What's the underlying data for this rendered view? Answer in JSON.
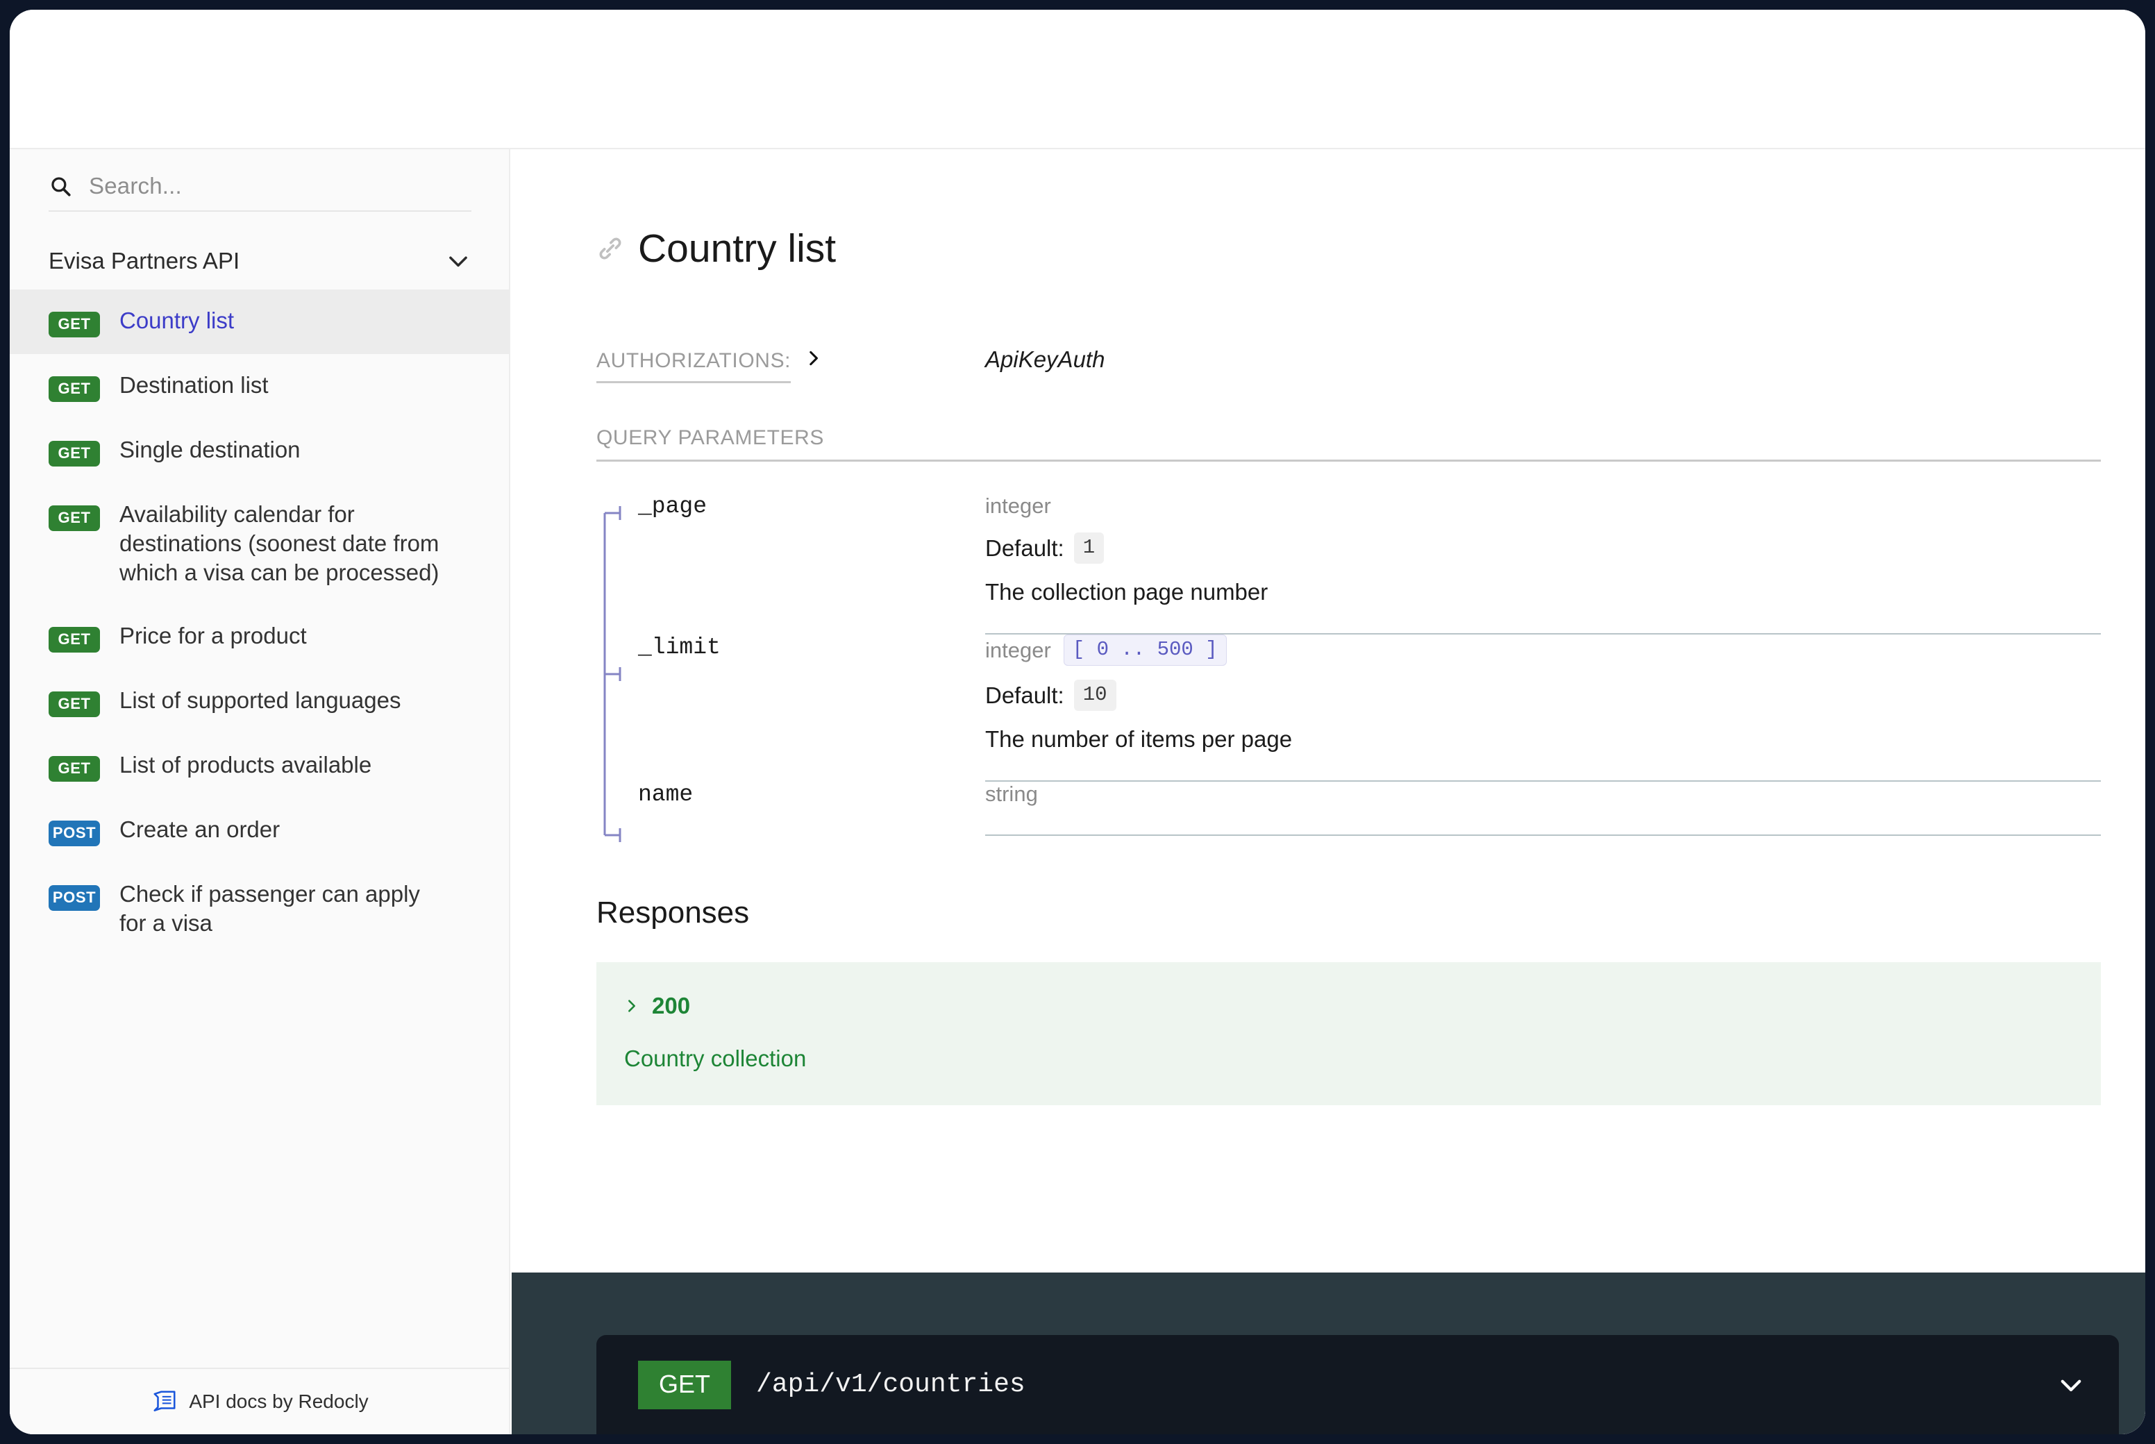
{
  "search": {
    "placeholder": "Search..."
  },
  "sidebar": {
    "group_label": "Evisa Partners API",
    "items": [
      {
        "method": "GET",
        "label": "Country list"
      },
      {
        "method": "GET",
        "label": "Destination list"
      },
      {
        "method": "GET",
        "label": "Single destination"
      },
      {
        "method": "GET",
        "label": "Availability calendar for destinations (soonest date from which a visa can be processed)"
      },
      {
        "method": "GET",
        "label": "Price for a product"
      },
      {
        "method": "GET",
        "label": "List of supported languages"
      },
      {
        "method": "GET",
        "label": "List of products available"
      },
      {
        "method": "POST",
        "label": "Create an order"
      },
      {
        "method": "POST",
        "label": "Check if passenger can apply for a visa"
      }
    ],
    "footer": {
      "label": "API docs by Redocly"
    }
  },
  "main": {
    "title": "Country list",
    "authorizations": {
      "label": "AUTHORIZATIONS:",
      "value": "ApiKeyAuth"
    },
    "query_parameters_label": "QUERY PARAMETERS",
    "parameters": [
      {
        "name": "_page",
        "type": "integer",
        "range": "",
        "default_label": "Default:",
        "default": "1",
        "description": "The collection page number"
      },
      {
        "name": "_limit",
        "type": "integer",
        "range": "[ 0 .. 500 ]",
        "default_label": "Default:",
        "default": "10",
        "description": "The number of items per page"
      },
      {
        "name": "name",
        "type": "string",
        "range": "",
        "default_label": "",
        "default": "",
        "description": ""
      }
    ],
    "responses_title": "Responses",
    "responses": [
      {
        "code": "200",
        "description": "Country collection"
      }
    ]
  },
  "endpoint": {
    "method": "GET",
    "path": "/api/v1/countries"
  },
  "colors": {
    "get": "#2f8132",
    "post": "#2175b8",
    "accent_link": "#3c3cc8",
    "success": "#1d8536",
    "dark_panel": "#2b3a41",
    "dark_bar": "#121821",
    "frame": "#0d1628"
  }
}
